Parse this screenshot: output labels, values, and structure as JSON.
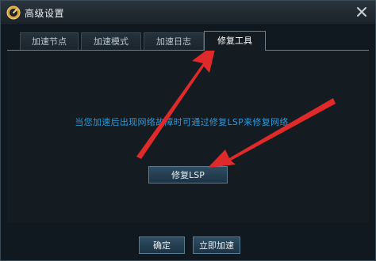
{
  "window": {
    "title": "高级设置",
    "logo_icon": "speed-dial-logo-icon",
    "close_icon": "close-icon"
  },
  "tabs": [
    {
      "label": "加速节点",
      "active": false
    },
    {
      "label": "加速模式",
      "active": false
    },
    {
      "label": "加速日志",
      "active": false
    },
    {
      "label": "修复工具",
      "active": true
    }
  ],
  "panel": {
    "tip": "当您加速后出现网络故障时可通过修复LSP来修复网络",
    "repair_button": "修复LSP"
  },
  "footer": {
    "ok_button": "确定",
    "speed_button": "立即加速"
  },
  "colors": {
    "accent_text": "#2e98d8",
    "annotation_arrow": "#e02a2a"
  }
}
